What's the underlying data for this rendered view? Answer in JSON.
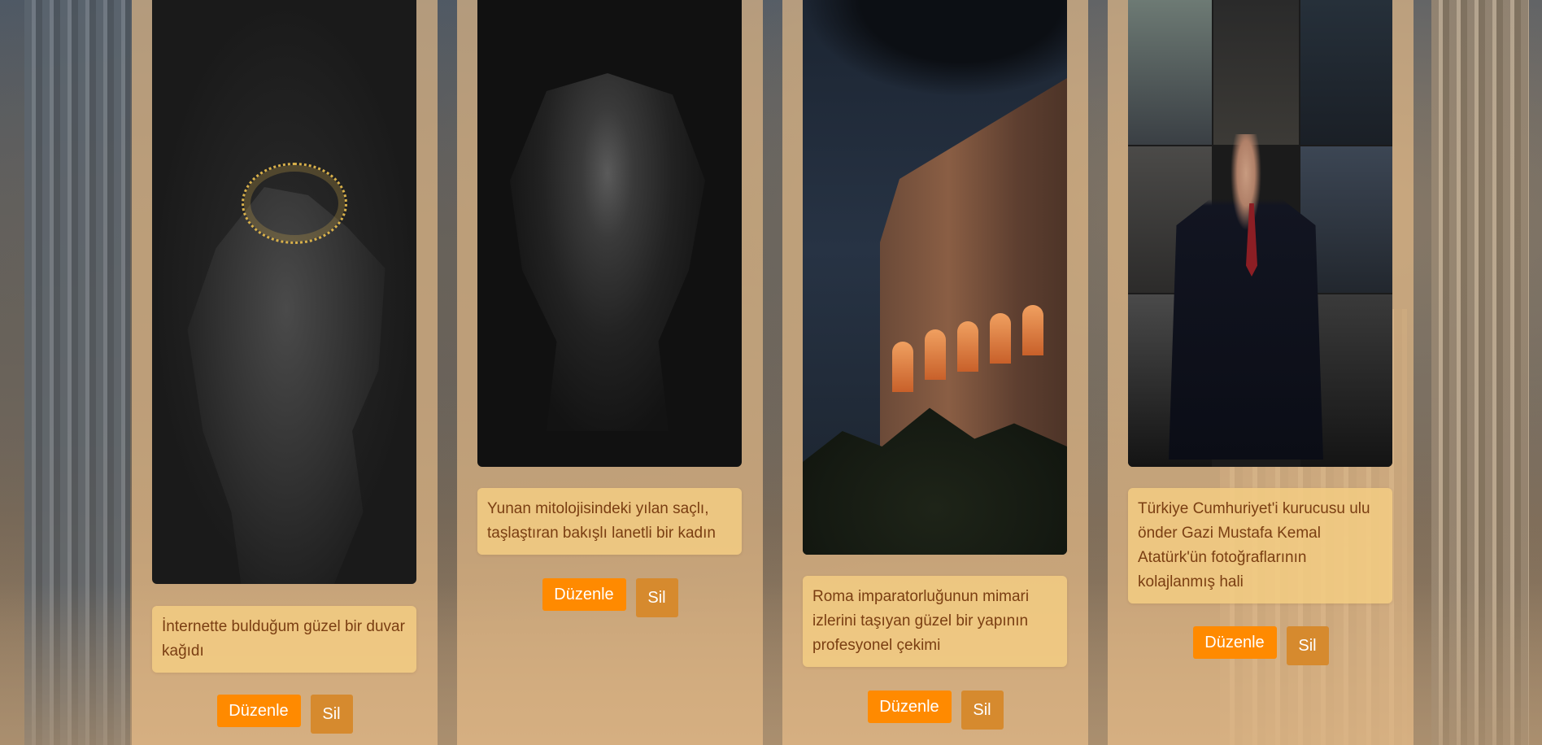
{
  "cards": [
    {
      "image_alt": "Melek heykeli duvar kağıdı",
      "description": "İnternette bulduğum güzel bir duvar kağıdı",
      "edit_label": "Düzenle",
      "delete_label": "Sil"
    },
    {
      "image_alt": "Medusa heykeli",
      "description": "Yunan mitolojisindeki yılan saçlı, taşlaştıran bakışlı lanetli bir kadın",
      "edit_label": "Düzenle",
      "delete_label": "Sil"
    },
    {
      "image_alt": "Kolezyum",
      "description": "Roma imparatorluğunun mimari izlerini taşıyan güzel bir yapının profesyonel çekimi",
      "edit_label": "Düzenle",
      "delete_label": "Sil"
    },
    {
      "image_alt": "Atatürk fotoğraf kolajı",
      "description": "Türkiye Cumhuriyet'i kurucusu ulu önder Gazi Mustafa Kemal Atatürk'ün fotoğraflarının kolajlanmış hali",
      "edit_label": "Düzenle",
      "delete_label": "Sil"
    }
  ],
  "colors": {
    "edit_button": "#ff8a00",
    "delete_button": "#d68a2e",
    "card_overlay": "#f0c48c",
    "description_bg": "#f3cd82",
    "description_text": "#7a3e12"
  }
}
